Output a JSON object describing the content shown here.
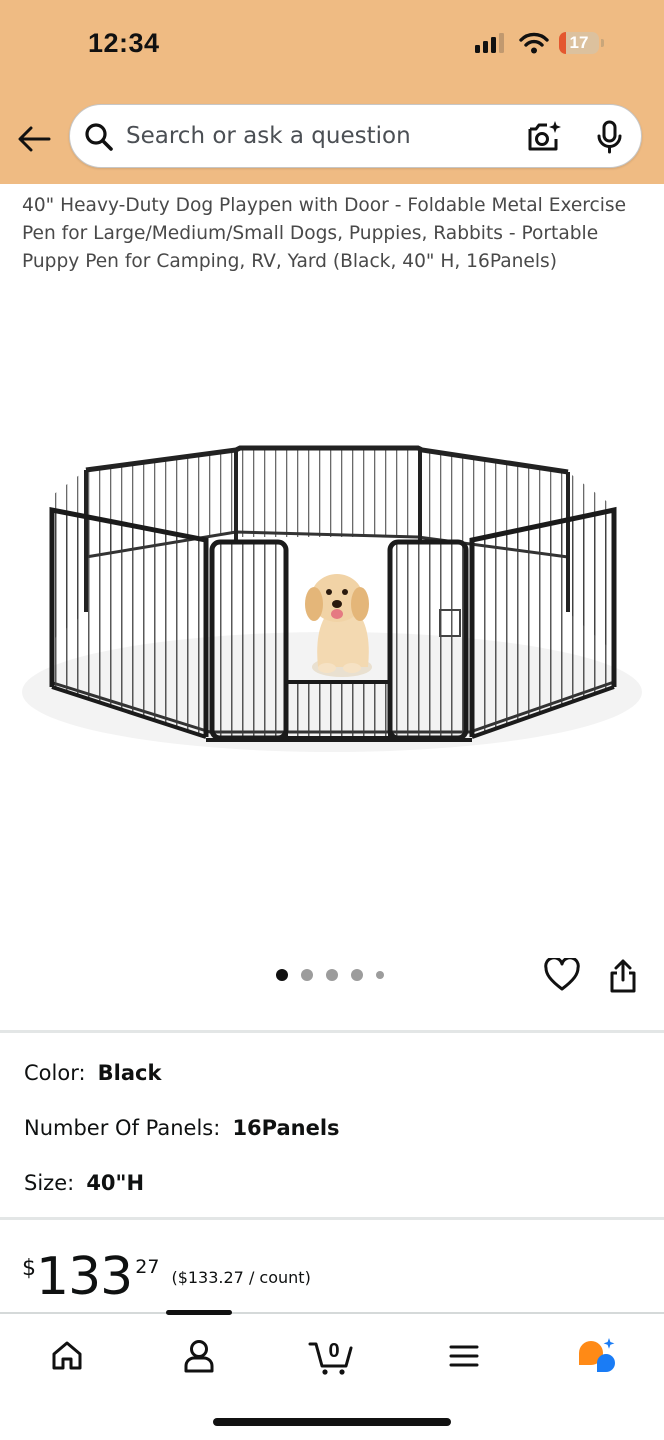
{
  "status_bar": {
    "time": "12:34",
    "battery": "17",
    "battery_level": 0.17
  },
  "header": {
    "search_placeholder": "Search or ask a question"
  },
  "product": {
    "title": "40\" Heavy-Duty Dog Playpen with Door - Foldable Metal Exercise Pen for Large/Medium/Small Dogs, Puppies, Rabbits - Portable Puppy Pen for Camping, RV, Yard (Black, 40\" H, 16Panels)",
    "image_count": 5,
    "active_image": 1
  },
  "variations": {
    "color_label": "Color:",
    "color_value": "Black",
    "panels_label": "Number Of Panels:",
    "panels_value": "16Panels",
    "size_label": "Size:",
    "size_value": "40\"H"
  },
  "price": {
    "symbol": "$",
    "whole": "133",
    "fraction": "27",
    "unit_price": "($133.27 / count)"
  },
  "bottom_nav": {
    "cart_count": "0",
    "items": [
      "home-icon",
      "account-icon",
      "cart-icon",
      "menu-icon",
      "rufus-icon"
    ],
    "active": "account"
  },
  "colors": {
    "header_bg": "#efbb83",
    "rufus_orange": "#ff8a16",
    "rufus_blue": "#1a7cf5"
  }
}
